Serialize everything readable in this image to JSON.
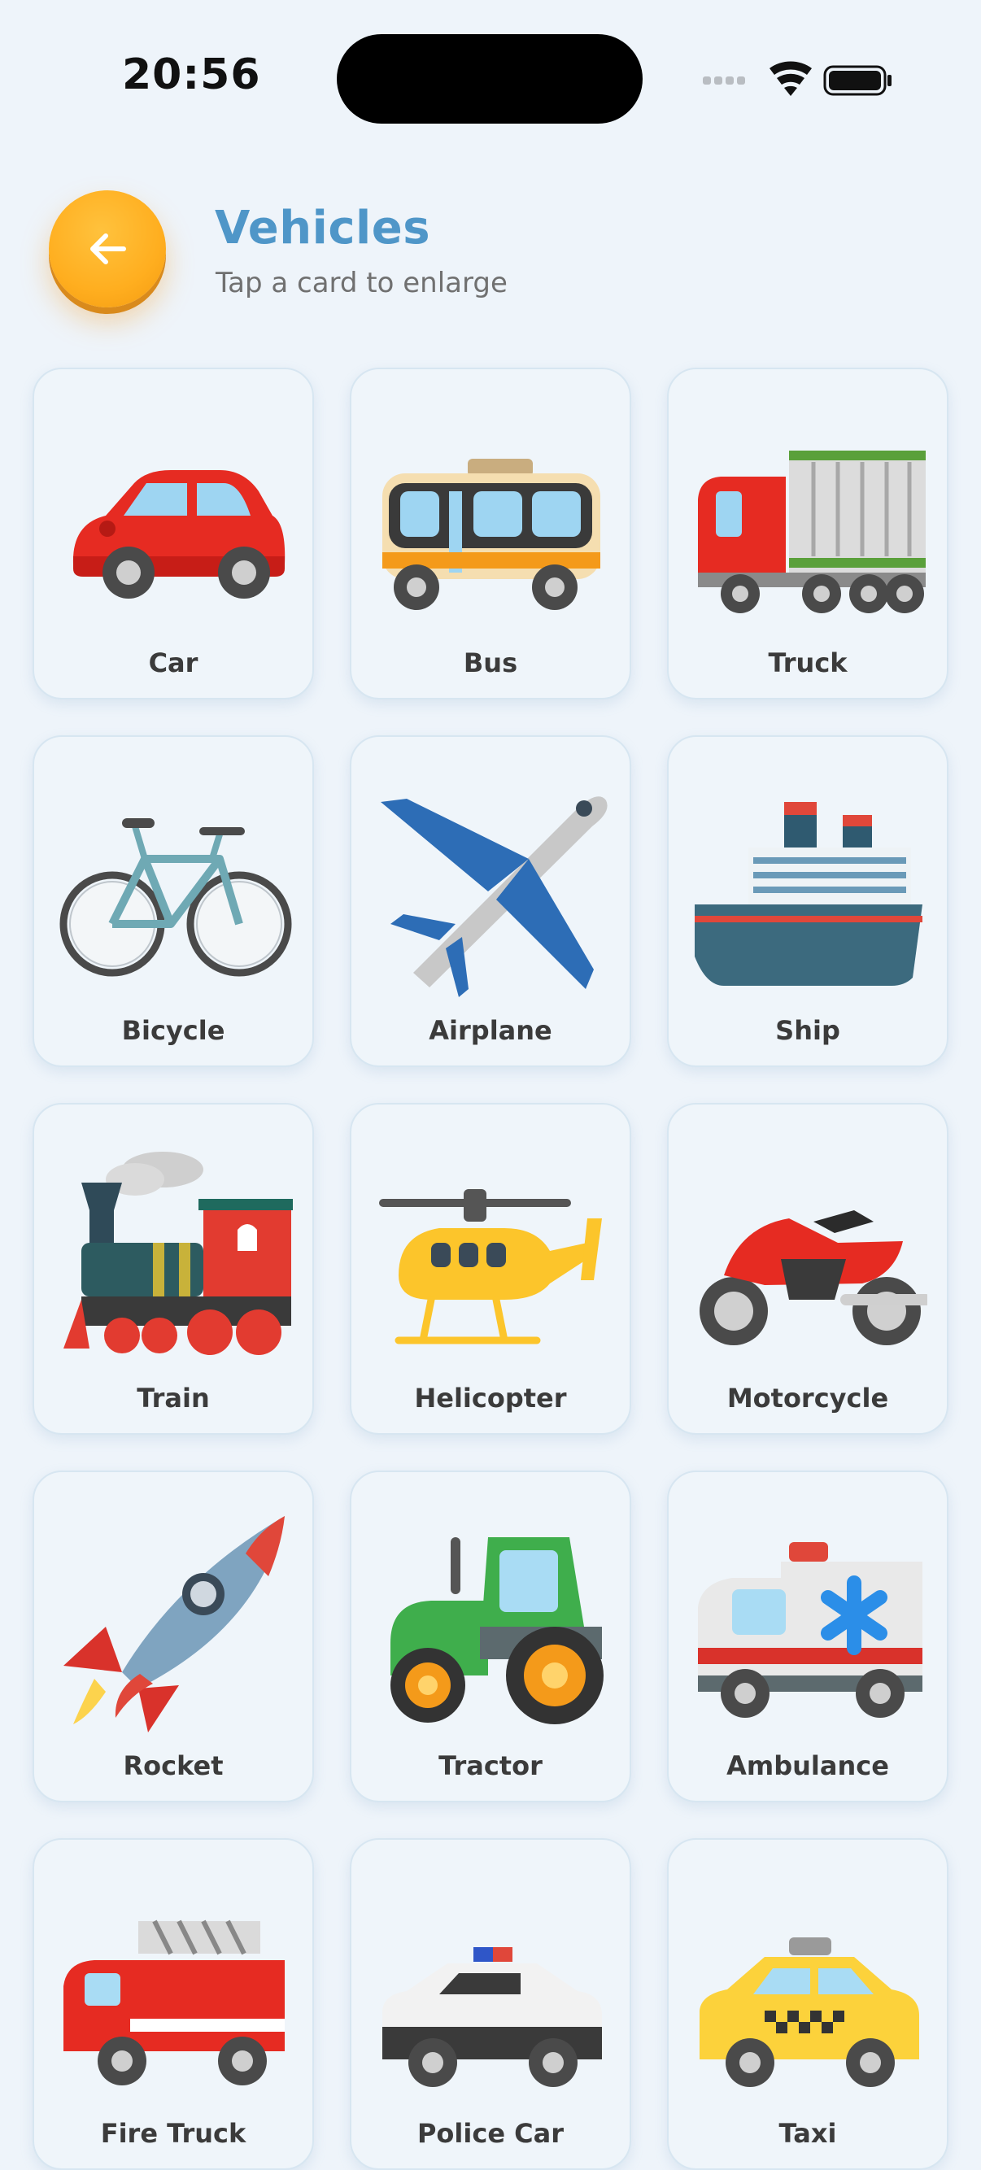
{
  "status_bar": {
    "time": "20:56"
  },
  "header": {
    "title": "Vehicles",
    "subtitle": "Tap a card to enlarge",
    "accent_color": "#4f96c8",
    "back_button_color": "#ffae1f"
  },
  "cards": [
    {
      "label": "Car",
      "icon": "car-icon"
    },
    {
      "label": "Bus",
      "icon": "bus-icon"
    },
    {
      "label": "Truck",
      "icon": "truck-icon"
    },
    {
      "label": "Bicycle",
      "icon": "bicycle-icon"
    },
    {
      "label": "Airplane",
      "icon": "airplane-icon"
    },
    {
      "label": "Ship",
      "icon": "ship-icon"
    },
    {
      "label": "Train",
      "icon": "train-icon"
    },
    {
      "label": "Helicopter",
      "icon": "helicopter-icon"
    },
    {
      "label": "Motorcycle",
      "icon": "motorcycle-icon"
    },
    {
      "label": "Rocket",
      "icon": "rocket-icon"
    },
    {
      "label": "Tractor",
      "icon": "tractor-icon"
    },
    {
      "label": "Ambulance",
      "icon": "ambulance-icon"
    },
    {
      "label": "Fire Truck",
      "icon": "fire-truck-icon"
    },
    {
      "label": "Police Car",
      "icon": "police-car-icon"
    },
    {
      "label": "Taxi",
      "icon": "taxi-icon"
    }
  ]
}
